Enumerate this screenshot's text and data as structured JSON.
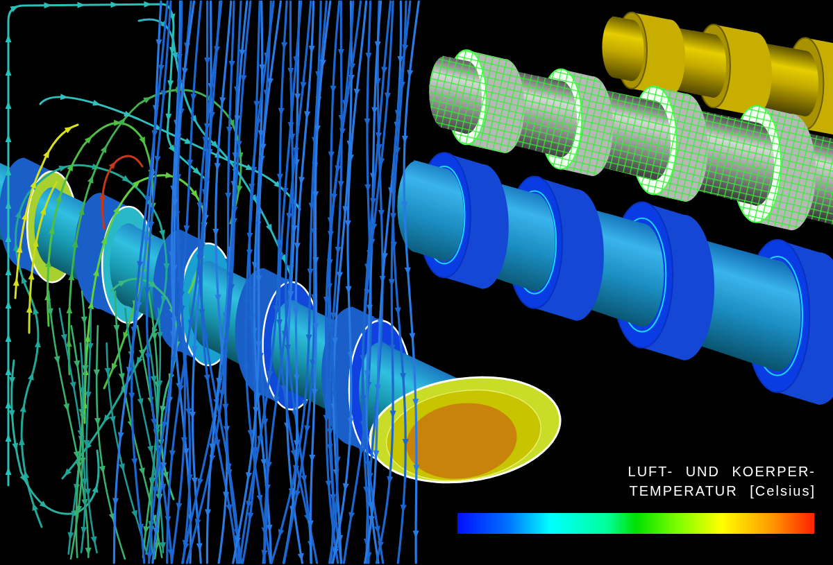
{
  "visualization": {
    "legend": {
      "title_lines": [
        "LUFT- UND KOERPER-",
        "TEMPERATUR [Celsius]"
      ]
    }
  }
}
